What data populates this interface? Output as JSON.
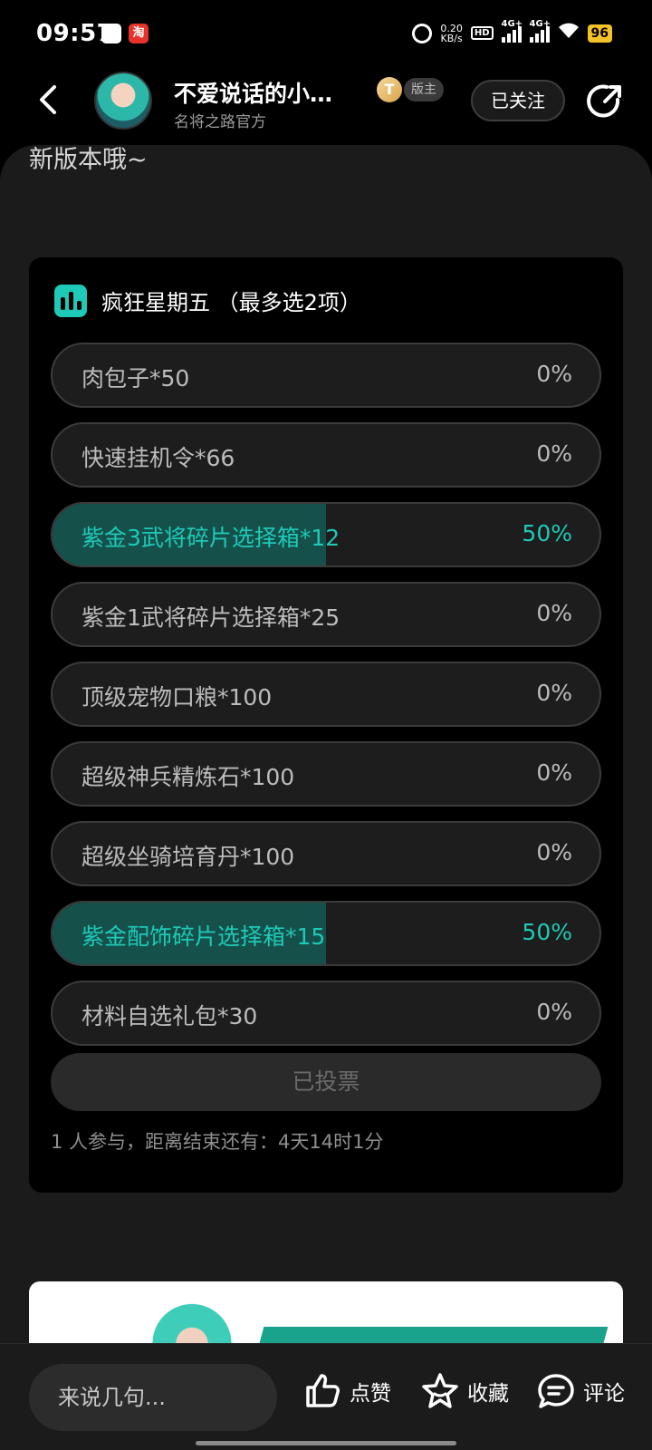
{
  "status_bar": {
    "time": "09:57",
    "netspeed_value": "0.20",
    "netspeed_unit": "KB/s",
    "hd": "HD",
    "signal1": "4G+",
    "signal2": "4G+",
    "battery": "96",
    "taobao": "淘"
  },
  "header": {
    "author_name": "不爱说话的小…",
    "author_subtitle": "名将之路官方",
    "level_badge": "T",
    "role_badge": "版主",
    "follow_label": "已关注"
  },
  "post": {
    "body_text_fragment": "新版本哦~"
  },
  "poll": {
    "title": "疯狂星期五 （最多选2项）",
    "accent_color": "#1ec9b7",
    "options": [
      {
        "label": "肉包子*50",
        "percent_text": "0%",
        "percent": 0,
        "selected": false
      },
      {
        "label": "快速挂机令*66",
        "percent_text": "0%",
        "percent": 0,
        "selected": false
      },
      {
        "label": "紫金3武将碎片选择箱*12",
        "percent_text": "50%",
        "percent": 50,
        "selected": true
      },
      {
        "label": "紫金1武将碎片选择箱*25",
        "percent_text": "0%",
        "percent": 0,
        "selected": false
      },
      {
        "label": "顶级宠物口粮*100",
        "percent_text": "0%",
        "percent": 0,
        "selected": false
      },
      {
        "label": "超级神兵精炼石*100",
        "percent_text": "0%",
        "percent": 0,
        "selected": false
      },
      {
        "label": "超级坐骑培育丹*100",
        "percent_text": "0%",
        "percent": 0,
        "selected": false
      },
      {
        "label": "紫金配饰碎片选择箱*15",
        "percent_text": "50%",
        "percent": 50,
        "selected": true
      },
      {
        "label": "材料自选礼包*30",
        "percent_text": "0%",
        "percent": 0,
        "selected": false
      }
    ],
    "vote_button_label": "已投票",
    "footer": "1 人参与，距离结束还有：4天14时1分"
  },
  "bottom_bar": {
    "comment_placeholder": "来说几句...",
    "like_label": "点赞",
    "favorite_label": "收藏",
    "comment_label": "评论"
  }
}
